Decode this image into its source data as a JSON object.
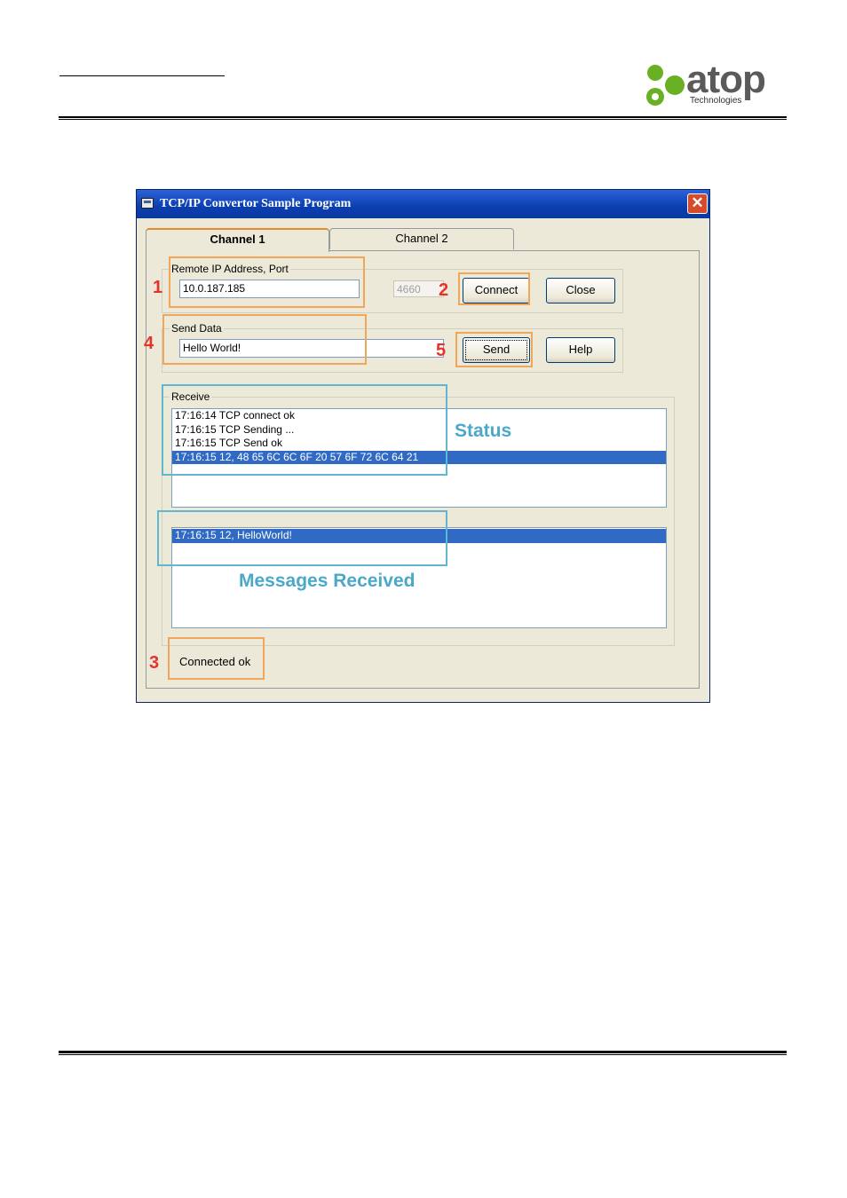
{
  "logo": {
    "text": "atop",
    "subtext": "Technologies",
    "green": "#6ab023"
  },
  "window": {
    "title": "TCP/IP Convertor Sample Program",
    "close_label": "✕"
  },
  "tabs": [
    {
      "label": "Channel 1",
      "active": true
    },
    {
      "label": "Channel 2",
      "active": false
    }
  ],
  "remote": {
    "group_label": "Remote IP Address, Port",
    "ip_value": "10.0.187.185",
    "port_value": "4660"
  },
  "buttons": {
    "connect": "Connect",
    "close": "Close",
    "send": "Send",
    "help": "Help"
  },
  "send_data": {
    "group_label": "Send Data",
    "value": "Hello World!"
  },
  "receive": {
    "group_label": "Receive",
    "status_lines": [
      "17:16:14 TCP connect ok",
      "17:16:15 TCP Sending ...",
      "17:16:15 TCP Send ok",
      "17:16:15 12, 48 65 6C 6C 6F 20 57 6F 72 6C 64 21"
    ],
    "messages": [
      "17:16:15 12, HelloWorld!"
    ]
  },
  "status_bar": {
    "text": "Connected ok"
  },
  "annotations": {
    "n1": "1",
    "n2": "2",
    "n3": "3",
    "n4": "4",
    "n5": "5",
    "status_label": "Status",
    "messages_label": "Messages Received",
    "orange": "#f2a65a",
    "blue": "#5fb8cf",
    "red": "#e6332a"
  }
}
